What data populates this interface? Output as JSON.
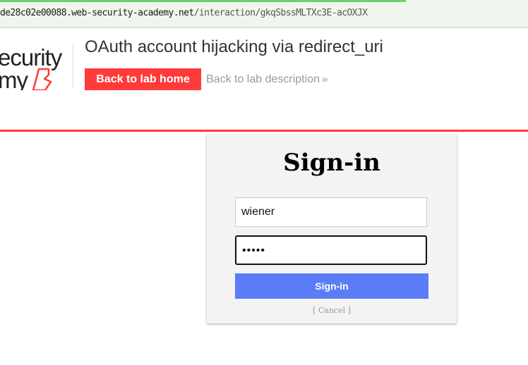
{
  "browser": {
    "url_host": "de28c02e00088.web-security-academy.net",
    "url_path": "/interaction/gkqSbssMLTXc3E-acOXJX"
  },
  "header": {
    "logo_line1": "ecurity",
    "logo_line2": "my",
    "lab_title": "OAuth account hijacking via redirect_uri",
    "back_home_label": "Back to lab home",
    "back_description_label": "Back to lab description",
    "chevron_icon": "double-chevron-right-icon"
  },
  "colors": {
    "accent_red": "#ff3a3a",
    "button_blue": "#5b7cf7"
  },
  "login": {
    "title": "Sign-in",
    "username_value": "wiener",
    "password_value": "•••••",
    "submit_label": "Sign-in",
    "cancel_label": "[ Cancel ]"
  }
}
